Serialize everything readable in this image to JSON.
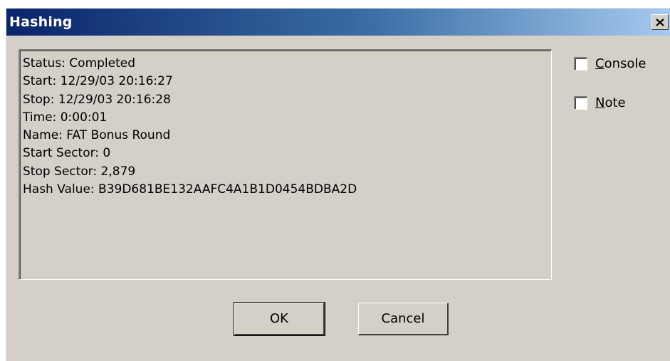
{
  "window": {
    "title": "Hashing",
    "close_label": "X"
  },
  "results": [
    {
      "label": "Status",
      "text": "Status: Completed"
    },
    {
      "label": "Start",
      "text": "Start: 12/29/03 20:16:27"
    },
    {
      "label": "Stop",
      "text": "Stop: 12/29/03 20:16:28"
    },
    {
      "label": "Time",
      "text": "Time: 0:00:01"
    },
    {
      "label": "Name",
      "text": "Name: FAT Bonus Round"
    },
    {
      "label": "Start Sector",
      "text": "Start Sector: 0"
    },
    {
      "label": "Stop Sector",
      "text": "Stop Sector: 2,879"
    },
    {
      "label": "Hash Value",
      "text": "Hash Value: B39D681BE132AAFC4A1B1D0454BDBA2D"
    }
  ],
  "options": {
    "console": {
      "access_key": "C",
      "rest": "onsole",
      "checked": false
    },
    "note": {
      "access_key": "N",
      "rest": "ote",
      "checked": false
    }
  },
  "buttons": {
    "ok_label": "OK",
    "cancel_label": "Cancel"
  },
  "colors": {
    "title_start": "#0a246a",
    "title_end": "#a6caf0",
    "face": "#d4d0c8"
  }
}
